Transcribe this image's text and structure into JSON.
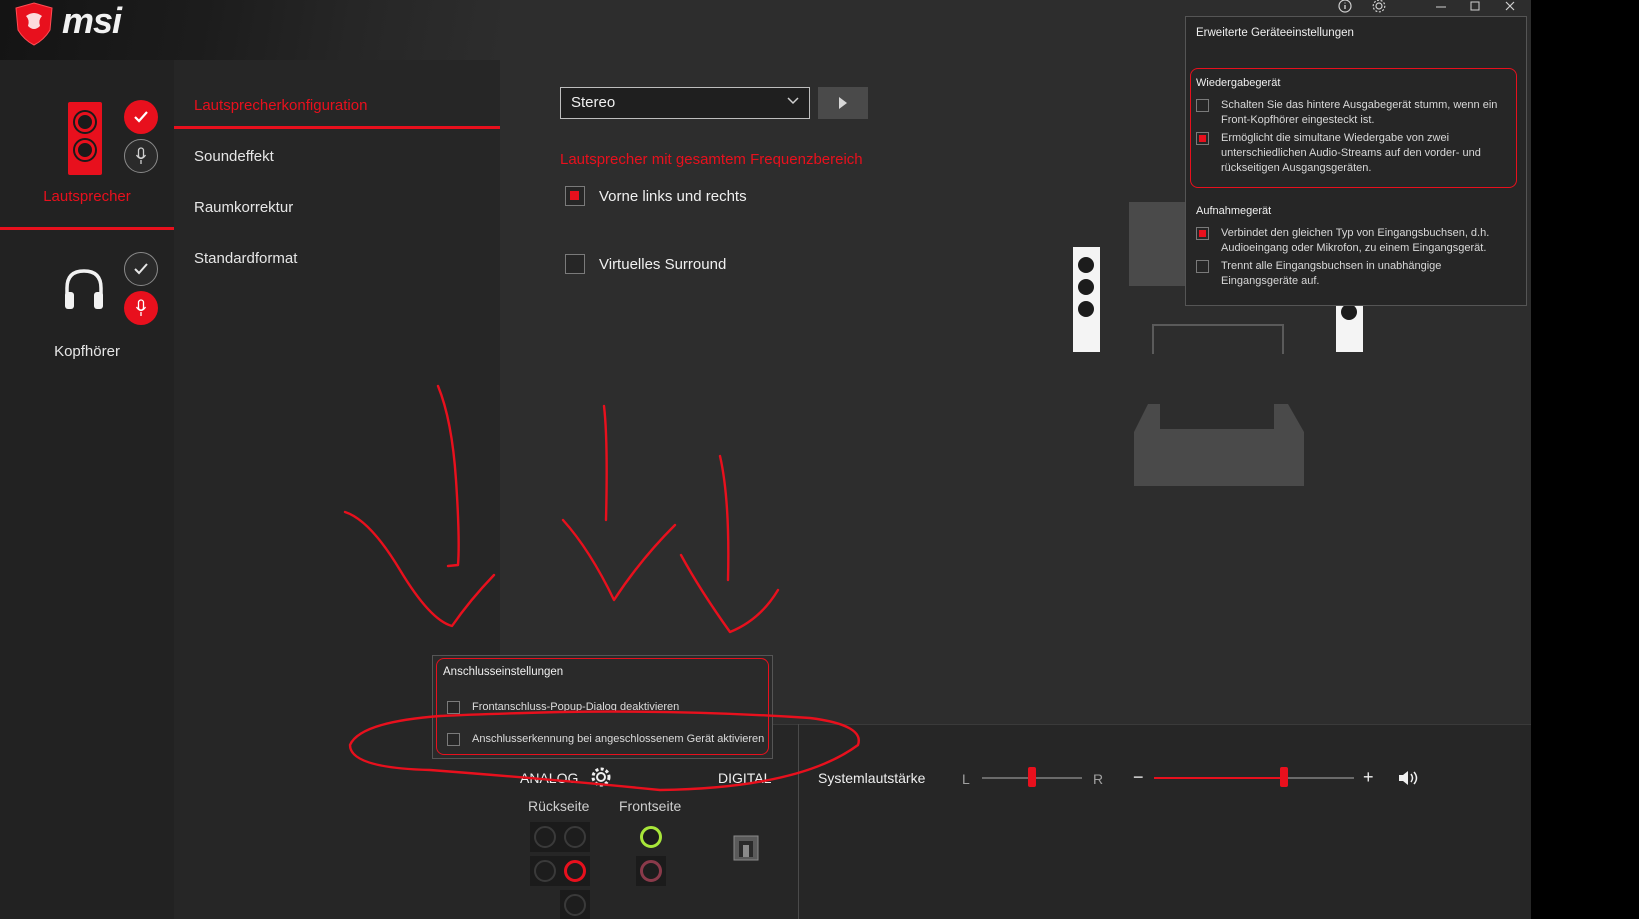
{
  "app": {
    "brand": "msi"
  },
  "devices": [
    {
      "label": "Lautsprecher",
      "active": true
    },
    {
      "label": "Kopfhörer",
      "active": false
    }
  ],
  "menu": {
    "items": [
      {
        "label": "Lautsprecherkonfiguration",
        "active": true
      },
      {
        "label": "Soundeffekt"
      },
      {
        "label": "Raumkorrektur"
      },
      {
        "label": "Standardformat"
      }
    ]
  },
  "config": {
    "speaker_select": "Stereo",
    "section_title": "Lautsprecher mit gesamtem Frequenzbereich",
    "front_lr": {
      "label": "Vorne links und rechts",
      "checked": true
    },
    "virtual_surround": {
      "label": "Virtuelles Surround",
      "checked": false
    }
  },
  "advanced": {
    "title": "Erweiterte Geräteeinstellungen",
    "playback_heading": "Wiedergabegerät",
    "playback": [
      {
        "text": "Schalten Sie das hintere Ausgabegerät stumm, wenn ein Front-Kopfhörer eingesteckt ist.",
        "checked": false
      },
      {
        "text": "Ermöglicht die simultane Wiedergabe von zwei unterschiedlichen Audio-Streams auf den vorder- und rückseitigen Ausgangsgeräten.",
        "checked": true
      }
    ],
    "record_heading": "Aufnahmegerät",
    "record": [
      {
        "text": "Verbindet den gleichen Typ von Eingangsbuchsen, d.h. Audioeingang oder Mikrofon, zu einem Eingangsgerät.",
        "checked": true
      },
      {
        "text": "Trennt alle Eingangsbuchsen in unabhängige Eingangsgeräte auf.",
        "checked": false
      }
    ]
  },
  "connector": {
    "title": "Anschlusseinstellungen",
    "options": [
      {
        "text": "Frontanschluss-Popup-Dialog deaktivieren",
        "checked": false
      },
      {
        "text": "Anschlusserkennung bei angeschlossenem Gerät aktivieren",
        "checked": false
      }
    ]
  },
  "bottom": {
    "analog": "ANALOG",
    "digital": "DIGITAL",
    "rear": "Rückseite",
    "front": "Frontseite",
    "system_volume": "Systemlautstärke",
    "balance_l": "L",
    "balance_r": "R",
    "minus": "−",
    "plus": "+",
    "balance_value": 0.5,
    "volume_value": 0.65
  },
  "colors": {
    "accent": "#e8101d",
    "jack_green": "#a8e63a",
    "jack_pink": "#8a3a4a"
  }
}
